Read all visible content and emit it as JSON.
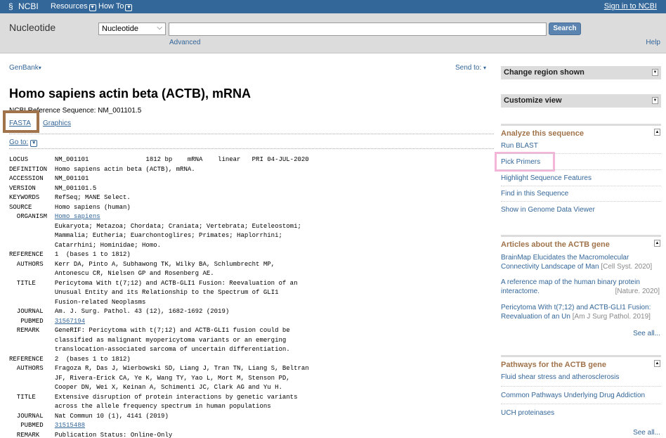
{
  "topbar": {
    "logo": "NCBI",
    "resources": "Resources",
    "howto": "How To",
    "signin": "Sign in to NCBI"
  },
  "search": {
    "db_name": "Nucleotide",
    "db_select": "Nucleotide",
    "query": "",
    "button": "Search",
    "advanced": "Advanced",
    "help": "Help"
  },
  "record_header": {
    "format": "GenBank",
    "send_to": "Send to:",
    "title": "Homo sapiens actin beta (ACTB), mRNA",
    "refseq": "NCBI Reference Sequence: NM_001101.5",
    "fasta": "FASTA",
    "graphics": "Graphics",
    "goto": "Go to:"
  },
  "record_lines": [
    {
      "k": "LOCUS       ",
      "v": "NM_001101               1812 bp    mRNA    linear   PRI 04-JUL-2020"
    },
    {
      "k": "DEFINITION  ",
      "v": "Homo sapiens actin beta (ACTB), mRNA."
    },
    {
      "k": "ACCESSION   ",
      "v": "NM_001101"
    },
    {
      "k": "VERSION     ",
      "v": "NM_001101.5"
    },
    {
      "k": "KEYWORDS    ",
      "v": "RefSeq; MANE Select."
    },
    {
      "k": "SOURCE      ",
      "v": "Homo sapiens (human)"
    },
    {
      "k": "  ORGANISM  ",
      "v": "Homo sapiens",
      "link": true
    },
    {
      "k": "            ",
      "v": "Eukaryota; Metazoa; Chordata; Craniata; Vertebrata; Euteleostomi;"
    },
    {
      "k": "            ",
      "v": "Mammalia; Eutheria; Euarchontoglires; Primates; Haplorrhini;"
    },
    {
      "k": "            ",
      "v": "Catarrhini; Hominidae; Homo."
    },
    {
      "k": "REFERENCE   ",
      "v": "1  (bases 1 to 1812)"
    },
    {
      "k": "  AUTHORS   ",
      "v": "Kerr DA, Pinto A, Subhawong TK, Wilky BA, Schlumbrecht MP,"
    },
    {
      "k": "            ",
      "v": "Antonescu CR, Nielsen GP and Rosenberg AE."
    },
    {
      "k": "  TITLE     ",
      "v": "Pericytoma With t(7;12) and ACTB-GLI1 Fusion: Reevaluation of an"
    },
    {
      "k": "            ",
      "v": "Unusual Entity and its Relationship to the Spectrum of GLI1"
    },
    {
      "k": "            ",
      "v": "Fusion-related Neoplasms"
    },
    {
      "k": "  JOURNAL   ",
      "v": "Am. J. Surg. Pathol. 43 (12), 1682-1692 (2019)"
    },
    {
      "k": "   PUBMED   ",
      "v": "31567194",
      "link": true
    },
    {
      "k": "  REMARK    ",
      "v": "GeneRIF: Pericytoma with t(7;12) and ACTB-GLI1 fusion could be"
    },
    {
      "k": "            ",
      "v": "classified as malignant myopericytoma variants or an emerging"
    },
    {
      "k": "            ",
      "v": "translocation-associated sarcoma of uncertain differentiation."
    },
    {
      "k": "REFERENCE   ",
      "v": "2  (bases 1 to 1812)"
    },
    {
      "k": "  AUTHORS   ",
      "v": "Fragoza R, Das J, Wierbowski SD, Liang J, Tran TN, Liang S, Beltran"
    },
    {
      "k": "            ",
      "v": "JF, Rivera-Erick CA, Ye K, Wang TY, Yao L, Mort M, Stenson PD,"
    },
    {
      "k": "            ",
      "v": "Cooper DN, Wei X, Keinan A, Schimenti JC, Clark AG and Yu H."
    },
    {
      "k": "  TITLE     ",
      "v": "Extensive disruption of protein interactions by genetic variants"
    },
    {
      "k": "            ",
      "v": "across the allele frequency spectrum in human populations"
    },
    {
      "k": "  JOURNAL   ",
      "v": "Nat Commun 10 (1), 4141 (2019)"
    },
    {
      "k": "   PUBMED   ",
      "v": "31515488",
      "link": true
    },
    {
      "k": "  REMARK    ",
      "v": "Publication Status: Online-Only"
    }
  ],
  "sidebar": {
    "change_region": "Change region shown",
    "customize_view": "Customize view",
    "analyze": {
      "title": "Analyze this sequence",
      "items": [
        "Run BLAST",
        "Pick Primers",
        "Highlight Sequence Features",
        "Find in this Sequence",
        "Show in Genome Data Viewer"
      ]
    },
    "articles": {
      "title": "Articles about the ACTB gene",
      "items": [
        {
          "text": "BrainMap Elucidates the Macromolecular Connectivity Landscape of Man",
          "cite": "[Cell Syst. 2020]"
        },
        {
          "text": "A reference map of the human binary protein interactome.",
          "cite": "[Nature. 2020]"
        },
        {
          "text": "Pericytoma With t(7;12) and ACTB-GLI1 Fusion: Reevaluation of an Un",
          "cite": "[Am J Surg Pathol. 2019]"
        }
      ],
      "see_all": "See all..."
    },
    "pathways": {
      "title": "Pathways for the ACTB gene",
      "items": [
        "Fluid shear stress and atherosclerosis",
        "Common Pathways Underlying Drug Addiction",
        "UCH proteinases"
      ],
      "see_all": "See all..."
    }
  },
  "colors": {
    "header_blue": "#336699",
    "link": "#336699",
    "section_title": "#a0734a",
    "fasta_highlight": "#a0734a",
    "pick_primers_highlight": "#f4b6d8"
  },
  "icons": {
    "logo": "ncbi-helix-icon",
    "dropdown": "chevron-down-icon",
    "collapse": "triangle-toggle-icon"
  }
}
